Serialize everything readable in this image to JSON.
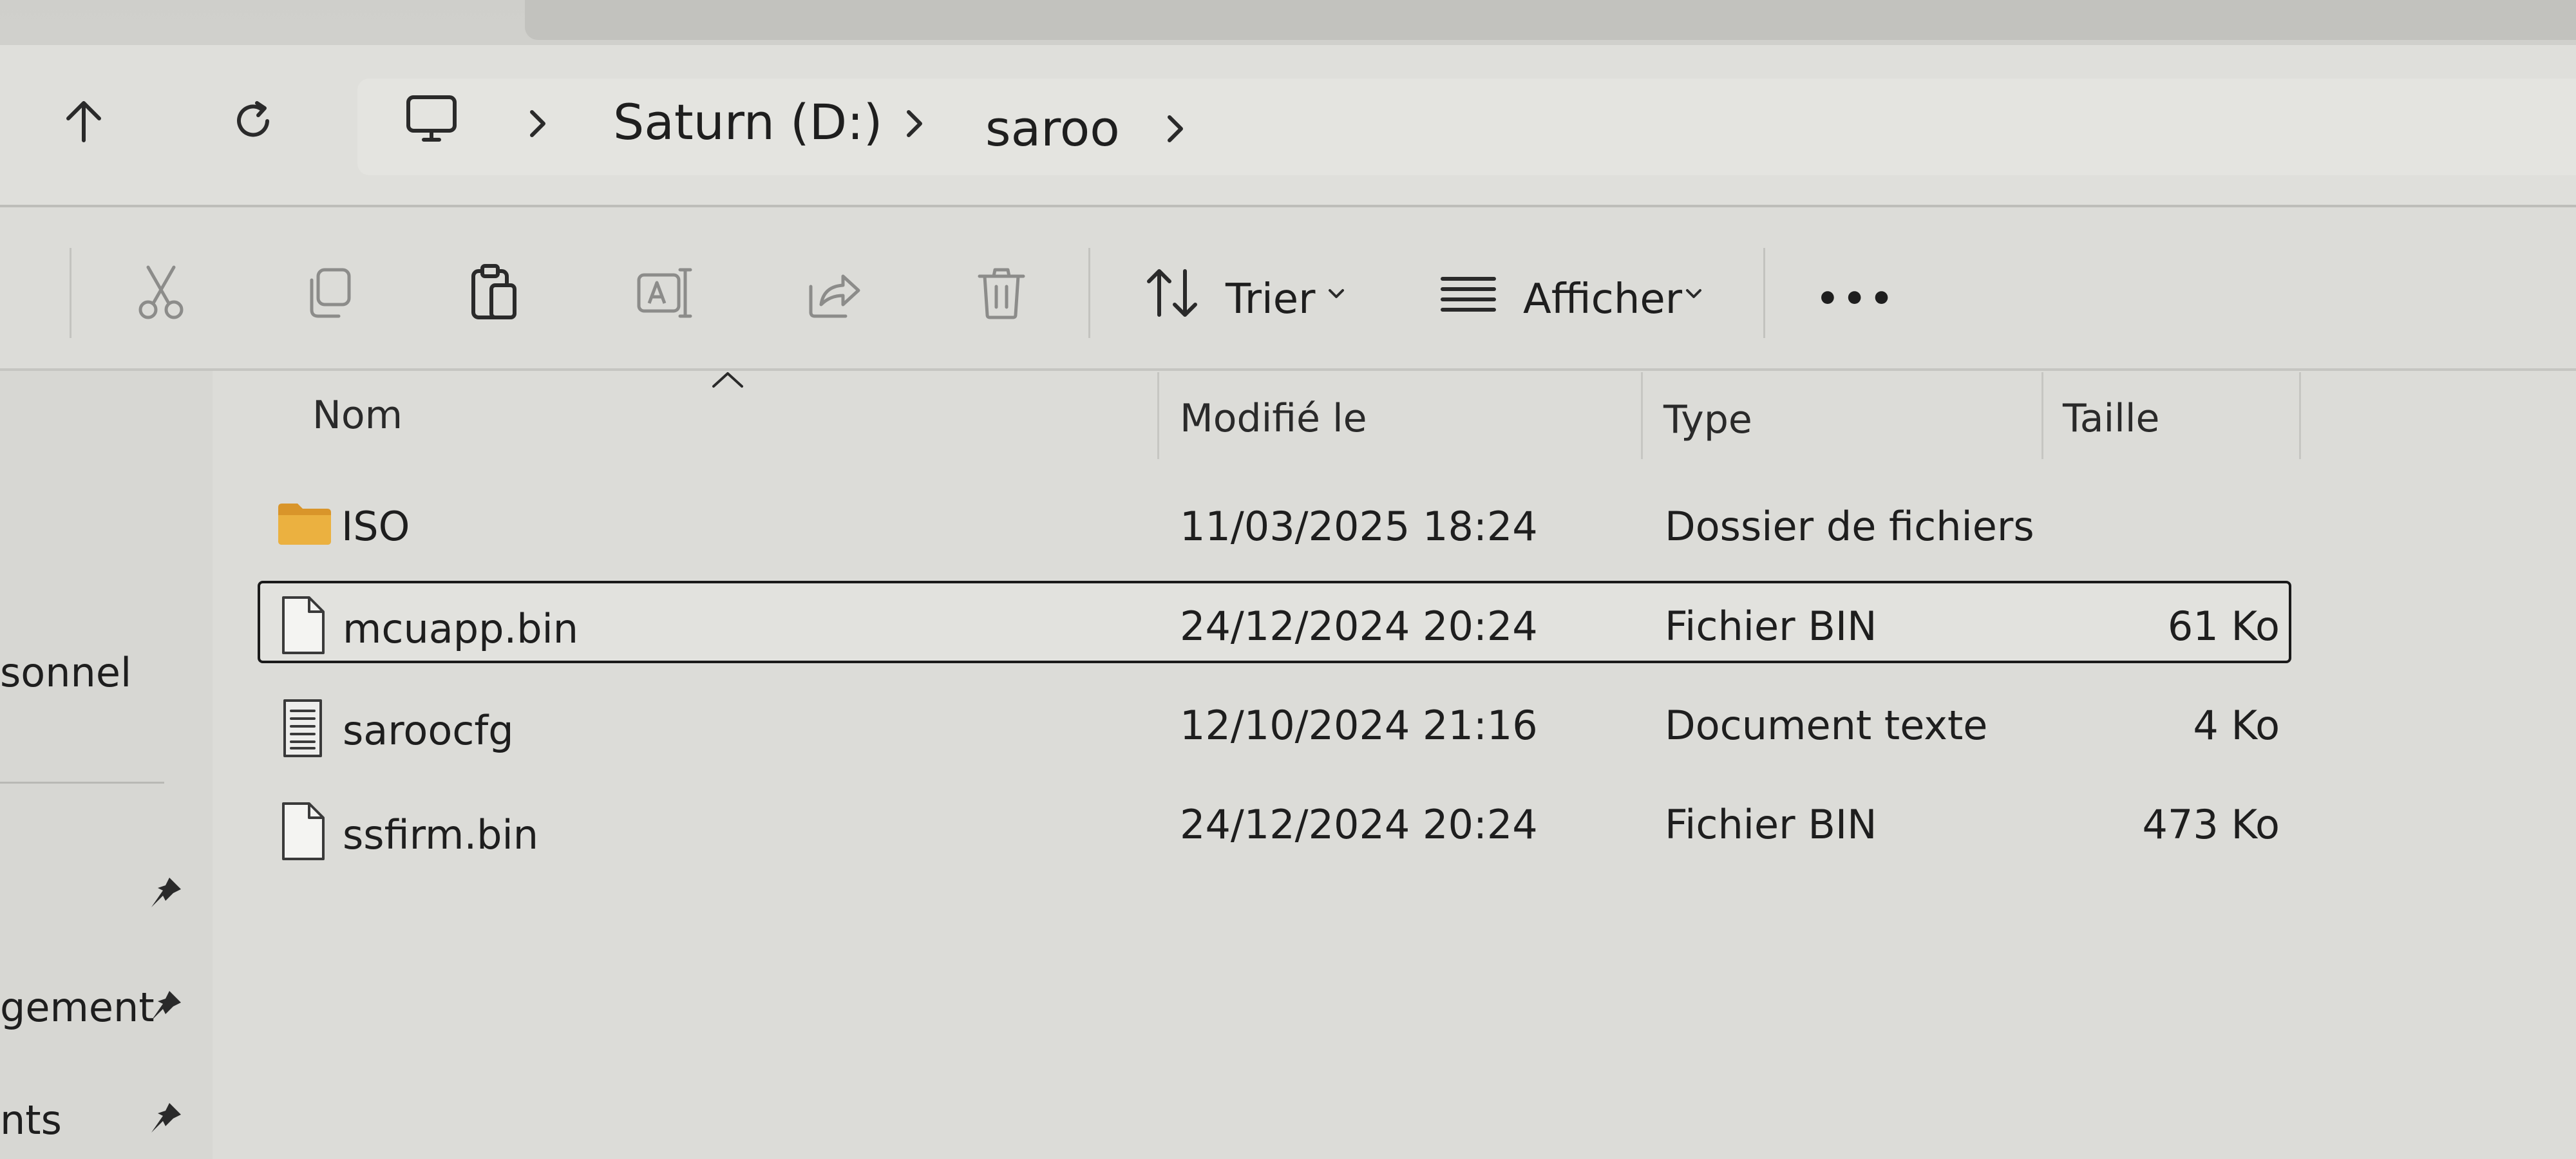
{
  "breadcrumb": {
    "items": [
      "Saturn (D:)",
      "saroo"
    ]
  },
  "toolbar": {
    "sort_label": "Trier",
    "view_label": "Afficher",
    "more_label": "•••"
  },
  "sidebar": {
    "items": [
      {
        "label": "sonnel",
        "pinned": false
      },
      {
        "label": "",
        "pinned": true
      },
      {
        "label": "gement",
        "pinned": true
      },
      {
        "label": "nts",
        "pinned": true
      }
    ]
  },
  "columns": {
    "name": "Nom",
    "modified": "Modifié le",
    "type": "Type",
    "size": "Taille"
  },
  "files": [
    {
      "name": "ISO",
      "modified": "11/03/2025 18:24",
      "type": "Dossier de fichiers",
      "size": "",
      "icon": "folder-icon",
      "selected": false
    },
    {
      "name": "mcuapp.bin",
      "modified": "24/12/2024 20:24",
      "type": "Fichier BIN",
      "size": "61 Ko",
      "icon": "file-icon",
      "selected": true
    },
    {
      "name": "saroocfg",
      "modified": "12/10/2024 21:16",
      "type": "Document texte",
      "size": "4 Ko",
      "icon": "text-document-icon",
      "selected": false
    },
    {
      "name": "ssfirm.bin",
      "modified": "24/12/2024 20:24",
      "type": "Fichier BIN",
      "size": "473 Ko",
      "icon": "file-icon",
      "selected": false
    }
  ],
  "colors": {
    "folder": "#e6a93a",
    "selection_border": "#1a1a1a",
    "background": "#dcdcd8"
  }
}
